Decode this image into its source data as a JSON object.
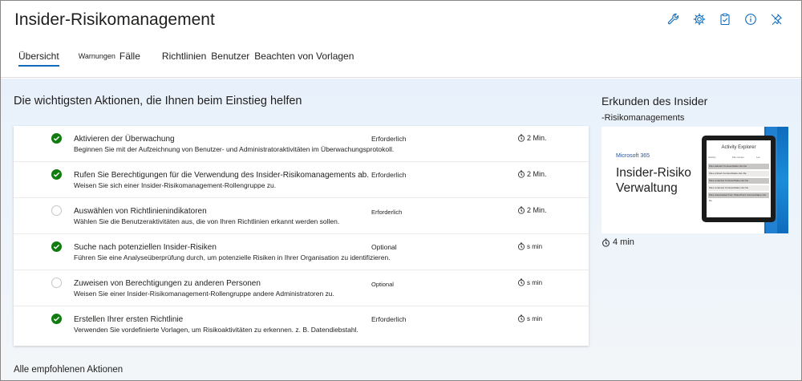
{
  "app": {
    "title": "Insider-Risikomanagement"
  },
  "header_icons": [
    "wrench-icon",
    "settings-icon",
    "clipboard-icon",
    "info-icon",
    "pin-icon"
  ],
  "tabs": [
    {
      "label": "Übersicht",
      "active": true
    },
    {
      "label": "Warnungen"
    },
    {
      "label": "Fälle"
    },
    {
      "label": "Richtlinien"
    },
    {
      "label": "Benutzer"
    },
    {
      "label": "Beachten von Vorlagen"
    }
  ],
  "actions": {
    "title": "Die wichtigsten Aktionen, die Ihnen beim Einstieg helfen",
    "rows": [
      {
        "title": "Aktivieren der Überwachung",
        "desc": "Beginnen Sie mit der Aufzeichnung von Benutzer- und Administratoraktivitäten im Überwachungsprotokoll.",
        "req": "Erforderlich",
        "time": "2 Min.",
        "done": true
      },
      {
        "title": "Rufen Sie Berechtigungen für die Verwendung des Insider-Risikomanagements ab.",
        "desc": "Weisen Sie sich einer Insider-Risikomanagement-Rollengruppe zu.",
        "req": "Erforderlich",
        "time": "2 Min.",
        "done": true
      },
      {
        "title": "Auswählen von Richtlinienindikatoren",
        "desc": "Wählen Sie die Benutzeraktivitäten aus, die von Ihren Richtlinien erkannt werden sollen.",
        "req": "Erforderlich",
        "time": "2 Min.",
        "done": false
      },
      {
        "title": "Suche nach potenziellen Insider-Risiken",
        "desc": "Führen Sie eine Analyseüberprüfung durch, um potenzielle Risiken in Ihrer Organisation zu identifizieren.",
        "req": "Optional",
        "time": "s min",
        "done": true
      },
      {
        "title": "Zuweisen von Berechtigungen zu anderen Personen",
        "desc": "Weisen Sie einer Insider-Risikomanagement-Rollengruppe andere Administratoren zu.",
        "req": "Optional",
        "time": "s min",
        "done": false
      },
      {
        "title": "Erstellen Ihrer ersten Richtlinie",
        "desc": "Verwenden Sie vordefinierte Vorlagen, um Risikoaktivitäten zu erkennen. z. B. Datendiebstahl.",
        "req": "Erforderlich",
        "time": "s min",
        "done": true
      }
    ],
    "all_link": "Alle empfohlenen Aktionen"
  },
  "explore": {
    "title": "Erkunden des Insider",
    "subtitle": "-Risikomanagements",
    "video": {
      "brand": "Microsoft 365",
      "title_line1": "Insider-Risiko",
      "title_line2": "Verwaltung",
      "screen_title": "Activity Explorer",
      "screen_cols": [
        "Activity",
        "File names",
        "Loc"
      ],
      "screen_rows": [
        {
          "a": "Files deleted",
          "b": "ContosoSales.xlsx",
          "c": "De"
        },
        {
          "a": "Files printed",
          "b": "ContosoSales.xlsx",
          "c": "De"
        },
        {
          "a": "Files renamed",
          "b": "ContosoSales.xlsx",
          "c": "De"
        },
        {
          "a": "Files renamed",
          "b": "ContosoSales.xlsx",
          "c": "De"
        },
        {
          "a": "Files downloaded from SharePoint",
          "b": "ContosoSales.xlsx",
          "c": "De"
        }
      ]
    },
    "duration": "4 min"
  },
  "colors": {
    "accent": "#0f6cbd",
    "success": "#107c10"
  }
}
